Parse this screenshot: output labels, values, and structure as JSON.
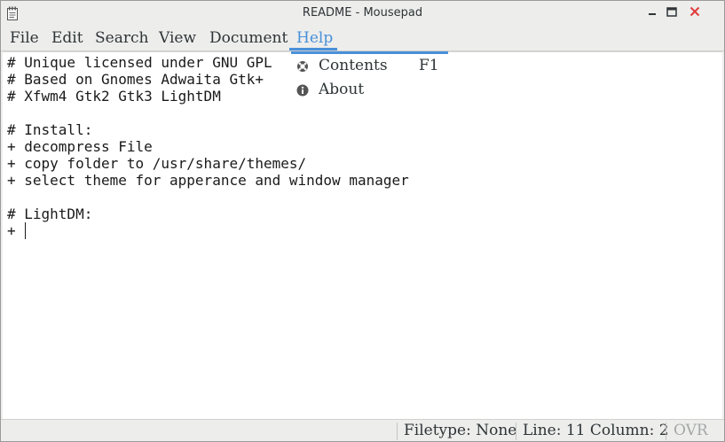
{
  "window": {
    "title": "README - Mousepad"
  },
  "menubar": {
    "items": [
      "File",
      "Edit",
      "Search",
      "View",
      "Document",
      "Help"
    ],
    "active": "Help"
  },
  "help_menu": {
    "items": [
      {
        "label": "Contents",
        "accel": "F1",
        "icon": "help-buoy-icon"
      },
      {
        "label": "About",
        "accel": "",
        "icon": "info-icon"
      }
    ]
  },
  "editor": {
    "lines": [
      "# Unique licensed under GNU GPL",
      "# Based on Gnomes Adwaita Gtk+",
      "# Xfwm4 Gtk2 Gtk3 LightDM",
      "",
      "# Install:",
      "+ decompress File",
      "+ copy folder to /usr/share/themes/",
      "+ select theme for apperance and window manager",
      "",
      "# LightDM:",
      "+ "
    ]
  },
  "statusbar": {
    "filetype": "Filetype: None",
    "position": "Line: 11 Column: 2",
    "mode": "OVR"
  },
  "colors": {
    "accent": "#4a90d9",
    "close_button": "#e03c3c"
  }
}
